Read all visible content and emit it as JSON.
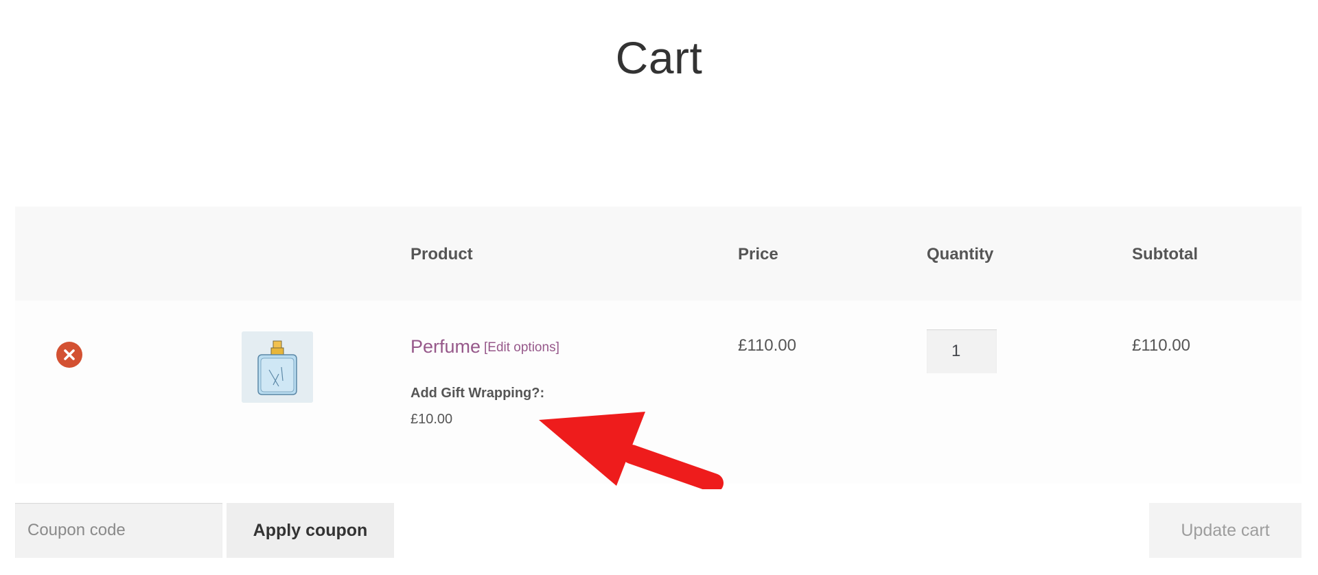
{
  "page": {
    "title": "Cart"
  },
  "table": {
    "headers": {
      "product": "Product",
      "price": "Price",
      "quantity": "Quantity",
      "subtotal": "Subtotal"
    },
    "rows": [
      {
        "product_name": "Perfume",
        "edit_options": "[Edit options]",
        "meta_label": "Add Gift Wrapping?:",
        "meta_value": "£10.00",
        "price": "£110.00",
        "quantity": "1",
        "subtotal": "£110.00"
      }
    ]
  },
  "actions": {
    "coupon_placeholder": "Coupon code",
    "apply_coupon_label": "Apply coupon",
    "update_cart_label": "Update cart"
  },
  "colors": {
    "product_link": "#96588a",
    "remove_icon": "#d35132",
    "annotation_arrow": "#ee1c1c"
  },
  "icons": {
    "remove": "close-circle-icon",
    "thumbnail": "perfume-bottle-image",
    "annotation": "arrow-annotation"
  }
}
